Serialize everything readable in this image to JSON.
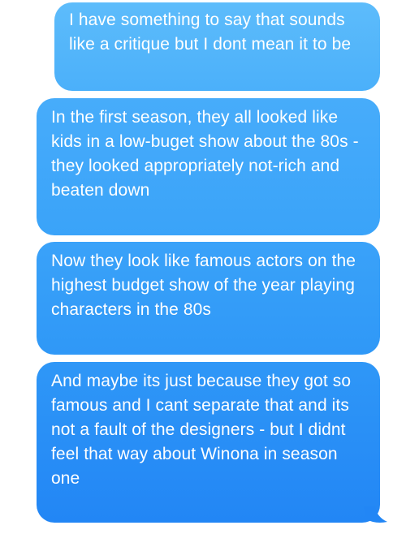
{
  "messages": [
    {
      "text": "I have something to say that sounds like a critique but I dont mean it to be"
    },
    {
      "text": "In the first season, they all looked like kids in a low-buget show about the 80s - they looked appropriately not-rich and beaten down"
    },
    {
      "text": "Now they look like famous actors on the highest budget show of the year playing characters in the 80s"
    },
    {
      "text": "And maybe its just because they got so famous and I cant separate that and its not a fault of the designers - but I didnt feel that way about Winona in season one"
    }
  ],
  "colors": {
    "bubble_top": "#5dbcfb",
    "bubble_bottom": "#2286f5",
    "text": "#ffffff",
    "background": "#ffffff"
  }
}
